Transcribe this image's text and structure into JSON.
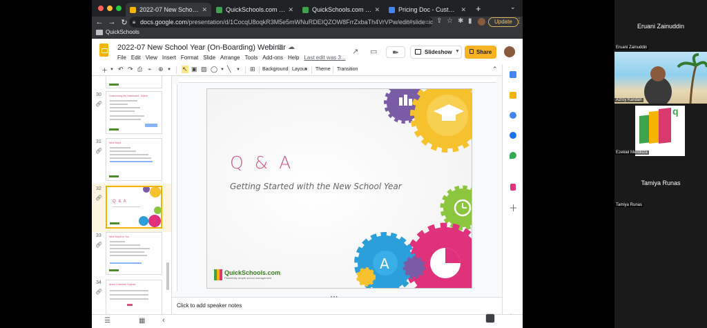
{
  "browser": {
    "tabs": [
      {
        "title": "2022-07 New School Year (On",
        "color": "#f4b400",
        "active": true
      },
      {
        "title": "QuickSchools.com - webinar",
        "color": "#3fa34d",
        "active": false
      },
      {
        "title": "QuickSchools.com - maesroyl",
        "color": "#3fa34d",
        "active": false
      },
      {
        "title": "Pricing Doc - Customizations",
        "color": "#4285f4",
        "active": false
      }
    ],
    "new_tab": "+",
    "tab_menu": "⌄",
    "url_host": "docs.google.com",
    "url_path": "/presentation/d/1CocqU8oqkR3M5e5mWNuRDEIQZOW8FrrZxbaTh4VrVPw/edit#slide=id.ge2045da...",
    "update_label": "Update",
    "bookmark": "QuickSchools"
  },
  "docs": {
    "title": "2022-07 New School Year (On-Boarding) Webinar",
    "menus": [
      "File",
      "Edit",
      "View",
      "Insert",
      "Format",
      "Slide",
      "Arrange",
      "Tools",
      "Add-ons",
      "Help"
    ],
    "last_edit": "Last edit was 3...",
    "slideshow_label": "Slideshow",
    "share_label": "Share",
    "toolbar": {
      "background": "Background",
      "layout": "Layout",
      "theme": "Theme",
      "transition": "Transition"
    }
  },
  "filmstrip": [
    {
      "num": "30",
      "title": "Customizing the Dashboard - Admin"
    },
    {
      "num": "31",
      "title": "Next Steps"
    },
    {
      "num": "32",
      "title": "Q & A",
      "selected": true
    },
    {
      "num": "33",
      "title": "Next Steps for You"
    },
    {
      "num": "34",
      "title": "About Customer Support"
    }
  ],
  "slide": {
    "heading": "Q & A",
    "subtitle": "Getting Started with the New School Year",
    "brand_name": "QuickSchools.com",
    "brand_tagline": "Powerfully simple school management"
  },
  "notes_placeholder": "Click to add speaker notes",
  "participants": {
    "host_top": "Eruani Zainuddin",
    "tiles": [
      {
        "name": "Eruani Zainuddin"
      },
      {
        "name": "Azroy Kandan"
      },
      {
        "name": "Ezekiel Mendoza"
      },
      {
        "name": "Tamiya Runas",
        "big": "Tamiya Runas"
      }
    ]
  },
  "colors": {
    "accent_pink": "#d4527e",
    "docs_yellow": "#f4b400",
    "share_yellow": "#f7b324",
    "gear_yellow": "#f5c22e",
    "gear_purple": "#7a5ba6",
    "gear_green": "#8cc63f",
    "gear_pink": "#e0327a",
    "gear_blue": "#2b9fd9"
  }
}
